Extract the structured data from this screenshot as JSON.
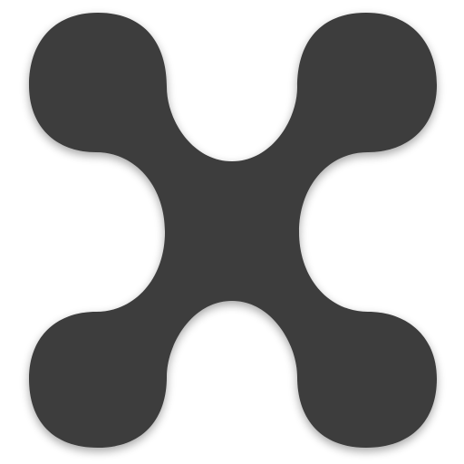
{
  "icon": {
    "name": "blob-x-icon",
    "fill_color": "#3c3c3c",
    "shadow_color": "#000000",
    "background_color": "#ffffff"
  }
}
